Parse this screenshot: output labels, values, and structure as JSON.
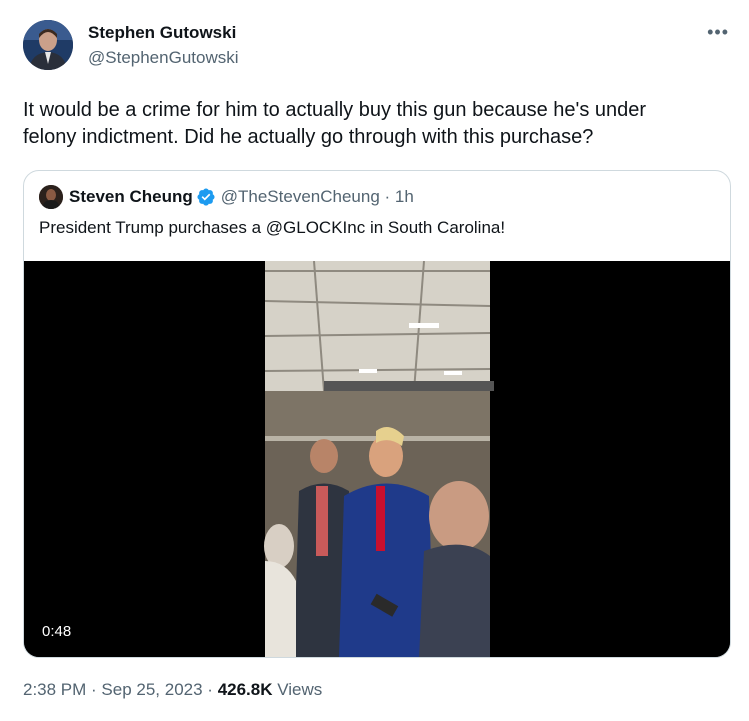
{
  "author": {
    "name": "Stephen Gutowski",
    "handle": "@StephenGutowski"
  },
  "more_icon_label": "•••",
  "tweet": {
    "line1": "It would be a crime for him to actually buy this gun because he's under",
    "line2": "felony indictment. Did he actually go through with this purchase?"
  },
  "quote": {
    "name": "Steven Cheung",
    "handle_time": "@TheStevenCheung · 1h",
    "text": "President Trump purchases a @GLOCKInc in South Carolina!",
    "video_duration": "0:48"
  },
  "footer": {
    "time": "2:38 PM",
    "sep1": " · ",
    "date": "Sep 25, 2023",
    "sep2": " · ",
    "views_count": "426.8K",
    "views_label": " Views"
  },
  "colors": {
    "accent": "#1d9bf0",
    "secondary_text": "#536471",
    "border": "#cfd9de"
  },
  "icons": [
    "avatar",
    "more-icon",
    "verified-badge-icon"
  ]
}
